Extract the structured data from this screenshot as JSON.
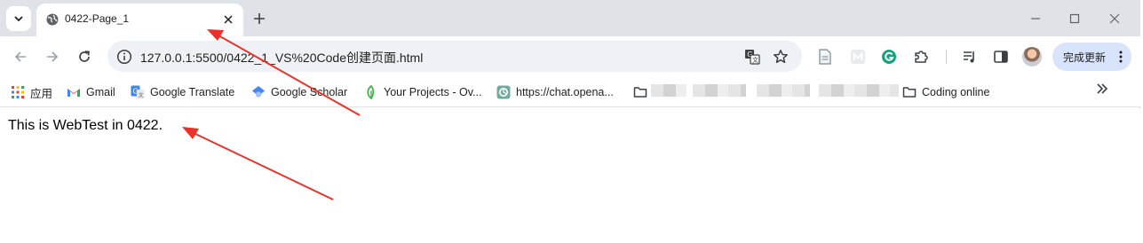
{
  "tab": {
    "title": "0422-Page_1"
  },
  "toolbar": {
    "url": "127.0.0.1:5500/0422_1_VS%20Code创建页面.html",
    "update_label": "完成更新"
  },
  "bookmarks": {
    "apps": "应用",
    "gmail": "Gmail",
    "google_translate": "Google Translate",
    "google_scholar": "Google Scholar",
    "your_projects": "Your Projects - Ov...",
    "chat": "https://chat.opena...",
    "coding_online": "Coding online"
  },
  "page": {
    "body_text": "This is WebTest in 0422."
  },
  "colors": {
    "annotation_arrow": "#e8322a",
    "tab_strip": "#dfe3e8",
    "omnibox": "#eef1f6",
    "update_button": "#d8e4fb"
  }
}
